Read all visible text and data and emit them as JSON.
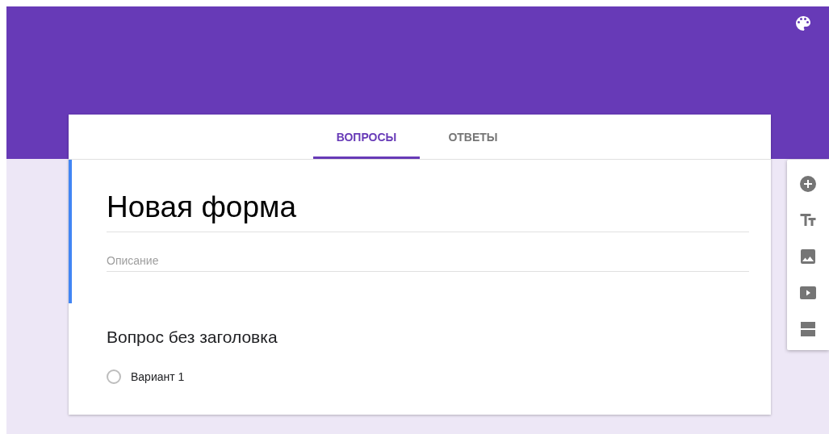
{
  "tabs": [
    {
      "label": "ВОПРОСЫ",
      "selected": true
    },
    {
      "label": "ОТВЕТЫ",
      "selected": false
    }
  ],
  "form": {
    "title": "Новая форма",
    "description_placeholder": "Описание"
  },
  "question": {
    "title": "Вопрос без заголовка",
    "options": [
      {
        "label": "Вариант 1",
        "selected": false
      }
    ]
  }
}
